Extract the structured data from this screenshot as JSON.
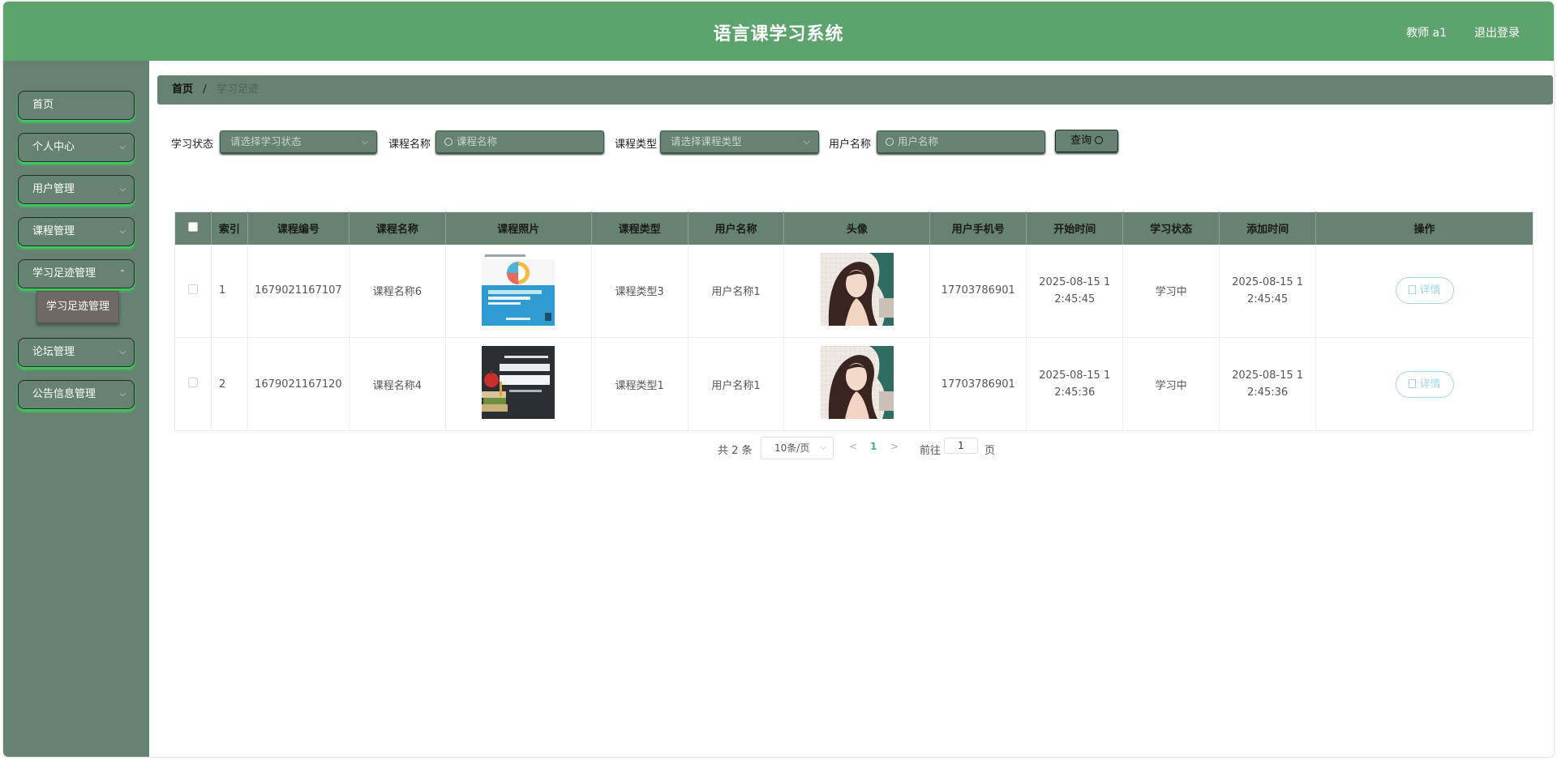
{
  "header": {
    "title": "语言课学习系统",
    "user": "教师 a1",
    "logout": "退出登录"
  },
  "sidebar": {
    "items": [
      {
        "label": "首页"
      },
      {
        "label": "个人中心"
      },
      {
        "label": "用户管理"
      },
      {
        "label": "课程管理"
      },
      {
        "label": "学习足迹管理"
      },
      {
        "label": "论坛管理"
      },
      {
        "label": "公告信息管理"
      }
    ],
    "active_sub": "学习足迹管理"
  },
  "breadcrumb": {
    "home": "首页",
    "sep": "/",
    "current": "学习足迹"
  },
  "search": {
    "status_label": "学习状态",
    "status_placeholder": "请选择学习状态",
    "course_name_label": "课程名称",
    "course_name_placeholder": "课程名称",
    "course_type_label": "课程类型",
    "course_type_placeholder": "请选择课程类型",
    "user_name_label": "用户名称",
    "user_name_placeholder": "用户名称",
    "query_button": "查询"
  },
  "table": {
    "headers": [
      "索引",
      "课程编号",
      "课程名称",
      "课程照片",
      "课程类型",
      "用户名称",
      "头像",
      "用户手机号",
      "开始时间",
      "学习状态",
      "添加时间",
      "操作"
    ],
    "rows": [
      {
        "index": "1",
        "course_no": "1679021167107",
        "course_name": "课程名称6",
        "course_type": "课程类型3",
        "user_name": "用户名称1",
        "phone": "17703786901",
        "start_time": "2025-08-15 12:45:45",
        "status": "学习中",
        "add_time": "2025-08-15 12:45:45",
        "action": "详情"
      },
      {
        "index": "2",
        "course_no": "1679021167120",
        "course_name": "课程名称4",
        "course_type": "课程类型1",
        "user_name": "用户名称1",
        "phone": "17703786901",
        "start_time": "2025-08-15 12:45:36",
        "status": "学习中",
        "add_time": "2025-08-15 12:45:36",
        "action": "详情"
      }
    ]
  },
  "pager": {
    "total": "共 2 条",
    "page_size": "10条/页",
    "current_page": "1",
    "goto_label": "前往",
    "goto_value": "1",
    "page_unit": "页"
  },
  "icons": {
    "dropdown": "chevron-down-icon",
    "search": "search-icon",
    "detail": "document-icon",
    "prev": "chevron-left-icon",
    "next": "chevron-right-icon"
  },
  "colors": {
    "header": "#5ca36d",
    "panel": "#668272",
    "glow": "#39d65a",
    "link": "#9fd6e8",
    "active_page": "#37b28d"
  }
}
